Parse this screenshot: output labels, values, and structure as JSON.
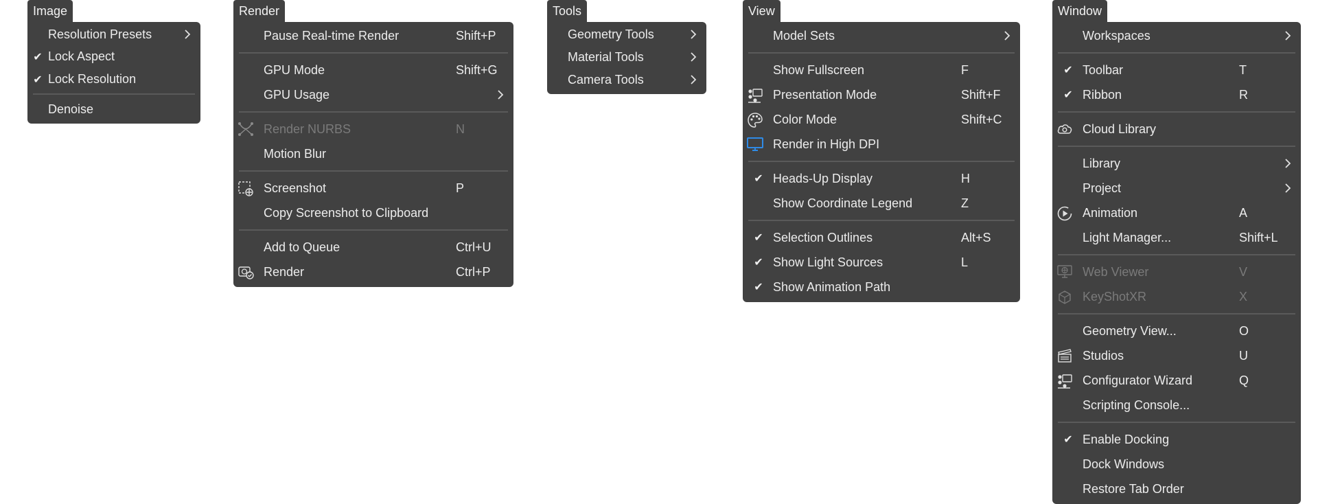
{
  "menus": {
    "image": {
      "title": "Image",
      "items": [
        {
          "label": "Resolution Presets",
          "submenu": true
        },
        {
          "label": "Lock Aspect",
          "checked": true
        },
        {
          "label": "Lock Resolution",
          "checked": true
        },
        {
          "label": "Denoise"
        }
      ]
    },
    "render": {
      "title": "Render",
      "items": [
        {
          "label": "Pause Real-time Render",
          "shortcut": "Shift+P"
        },
        {
          "label": "GPU Mode",
          "shortcut": "Shift+G"
        },
        {
          "label": "GPU Usage",
          "submenu": true
        },
        {
          "label": "Render NURBS",
          "shortcut": "N",
          "disabled": true,
          "icon": "nurbs-icon"
        },
        {
          "label": "Motion Blur"
        },
        {
          "label": "Screenshot",
          "shortcut": "P",
          "icon": "screenshot-icon"
        },
        {
          "label": "Copy Screenshot to Clipboard"
        },
        {
          "label": "Add to Queue",
          "shortcut": "Ctrl+U"
        },
        {
          "label": "Render",
          "shortcut": "Ctrl+P",
          "icon": "render-icon"
        }
      ]
    },
    "tools": {
      "title": "Tools",
      "items": [
        {
          "label": "Geometry Tools",
          "submenu": true
        },
        {
          "label": "Material Tools",
          "submenu": true
        },
        {
          "label": "Camera Tools",
          "submenu": true
        }
      ]
    },
    "view": {
      "title": "View",
      "items": [
        {
          "label": "Model Sets",
          "submenu": true
        },
        {
          "label": "Show Fullscreen",
          "shortcut": "F"
        },
        {
          "label": "Presentation Mode",
          "shortcut": "Shift+F",
          "icon": "presentation-icon"
        },
        {
          "label": "Color Mode",
          "shortcut": "Shift+C",
          "icon": "palette-icon"
        },
        {
          "label": "Render in High DPI",
          "icon": "monitor-icon"
        },
        {
          "label": "Heads-Up Display",
          "shortcut": "H",
          "checked": true
        },
        {
          "label": "Show Coordinate Legend",
          "shortcut": "Z"
        },
        {
          "label": "Selection Outlines",
          "shortcut": "Alt+S",
          "checked": true
        },
        {
          "label": "Show Light Sources",
          "shortcut": "L",
          "checked": true
        },
        {
          "label": "Show Animation Path",
          "checked": true
        }
      ]
    },
    "window": {
      "title": "Window",
      "items": [
        {
          "label": "Workspaces",
          "submenu": true
        },
        {
          "label": "Toolbar",
          "shortcut": "T",
          "checked": true
        },
        {
          "label": "Ribbon",
          "shortcut": "R",
          "checked": true
        },
        {
          "label": "Cloud Library",
          "icon": "cloud-library-icon"
        },
        {
          "label": "Library",
          "submenu": true
        },
        {
          "label": "Project",
          "submenu": true
        },
        {
          "label": "Animation",
          "shortcut": "A",
          "icon": "animation-icon"
        },
        {
          "label": "Light Manager...",
          "shortcut": "Shift+L"
        },
        {
          "label": "Web Viewer",
          "shortcut": "V",
          "disabled": true,
          "icon": "web-viewer-icon"
        },
        {
          "label": "KeyShotXR",
          "shortcut": "X",
          "disabled": true,
          "icon": "keyshotxr-icon"
        },
        {
          "label": "Geometry View...",
          "shortcut": "O"
        },
        {
          "label": "Studios",
          "shortcut": "U",
          "icon": "studios-icon"
        },
        {
          "label": "Configurator Wizard",
          "shortcut": "Q",
          "icon": "configurator-icon"
        },
        {
          "label": "Scripting Console..."
        },
        {
          "label": "Enable Docking",
          "checked": true
        },
        {
          "label": "Dock Windows"
        },
        {
          "label": "Restore Tab Order"
        }
      ]
    }
  },
  "glyphs": {
    "check": "✔"
  },
  "colors": {
    "menu_bg": "#414141",
    "separator": "#5a5a5a",
    "disabled_text": "#7a7a7a",
    "accent_blue": "#2f8be6"
  }
}
